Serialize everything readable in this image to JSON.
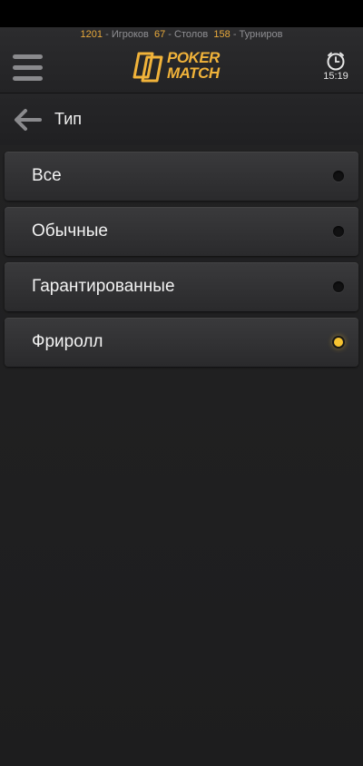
{
  "stats": {
    "players_count": "1201",
    "players_label": "Игроков",
    "tables_count": "67",
    "tables_label": "Столов",
    "tournaments_count": "158",
    "tournaments_label": "Турниров",
    "separator": " - "
  },
  "header": {
    "logo_line1": "POKER",
    "logo_line2": "MATCH",
    "menu_icon": "hamburger-icon",
    "clock_icon": "clock-icon",
    "time": "15:19"
  },
  "subheader": {
    "title": "Тип",
    "back_icon": "arrow-left-icon"
  },
  "options": [
    {
      "label": "Все",
      "selected": false
    },
    {
      "label": "Обычные",
      "selected": false
    },
    {
      "label": "Гарантированные",
      "selected": false
    },
    {
      "label": "Фриролл",
      "selected": true
    }
  ],
  "colors": {
    "accent": "#f1b33a",
    "count": "#e8a93b",
    "radio_selected": "#f6c331",
    "background": "#1e1e1f"
  }
}
